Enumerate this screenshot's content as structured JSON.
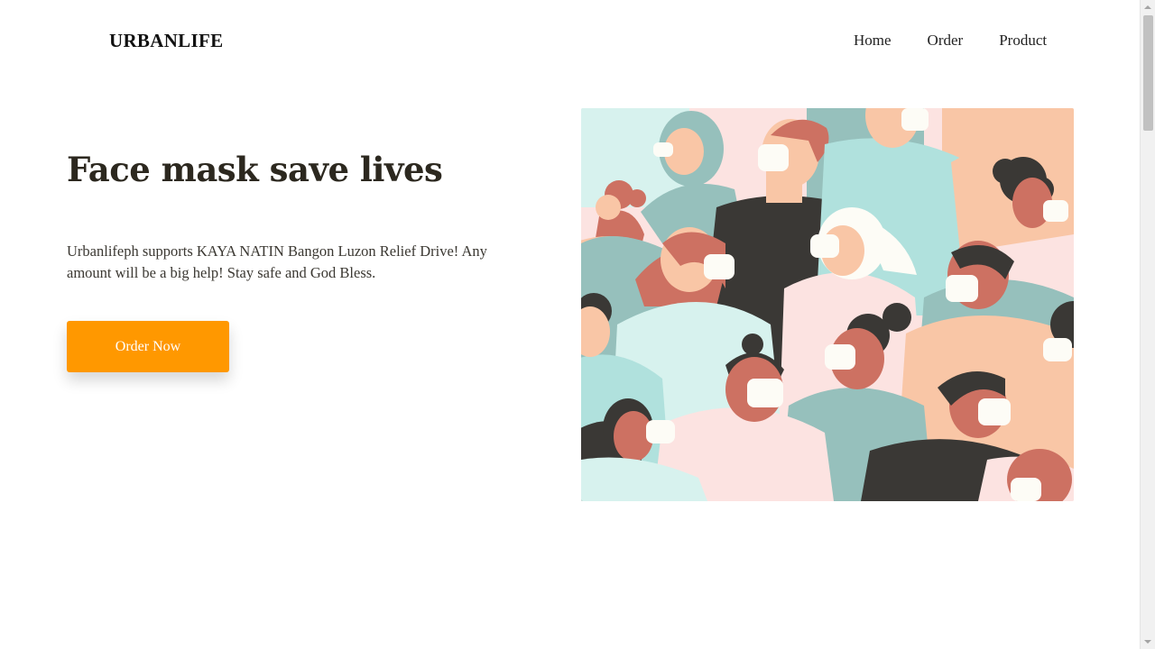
{
  "brand": {
    "name": "URBANLIFE"
  },
  "nav": {
    "items": [
      "Home",
      "Order",
      "Product"
    ]
  },
  "hero": {
    "title": "Face mask save lives",
    "description": "Urbanlifeph supports KAYA NATIN Bangon Luzon Relief Drive! Any amount will be a big help! Stay safe and God Bless.",
    "cta_label": "Order Now",
    "image_icon": "masked-people-illustration"
  },
  "colors": {
    "accent": "#ff9800",
    "text": "#2c281f",
    "illustration_palette": [
      "#b0e1dd",
      "#96c0bc",
      "#fce3e1",
      "#f9c6a6",
      "#cd7162",
      "#3a3835",
      "#fdfcf6",
      "#d7f2ee"
    ]
  }
}
